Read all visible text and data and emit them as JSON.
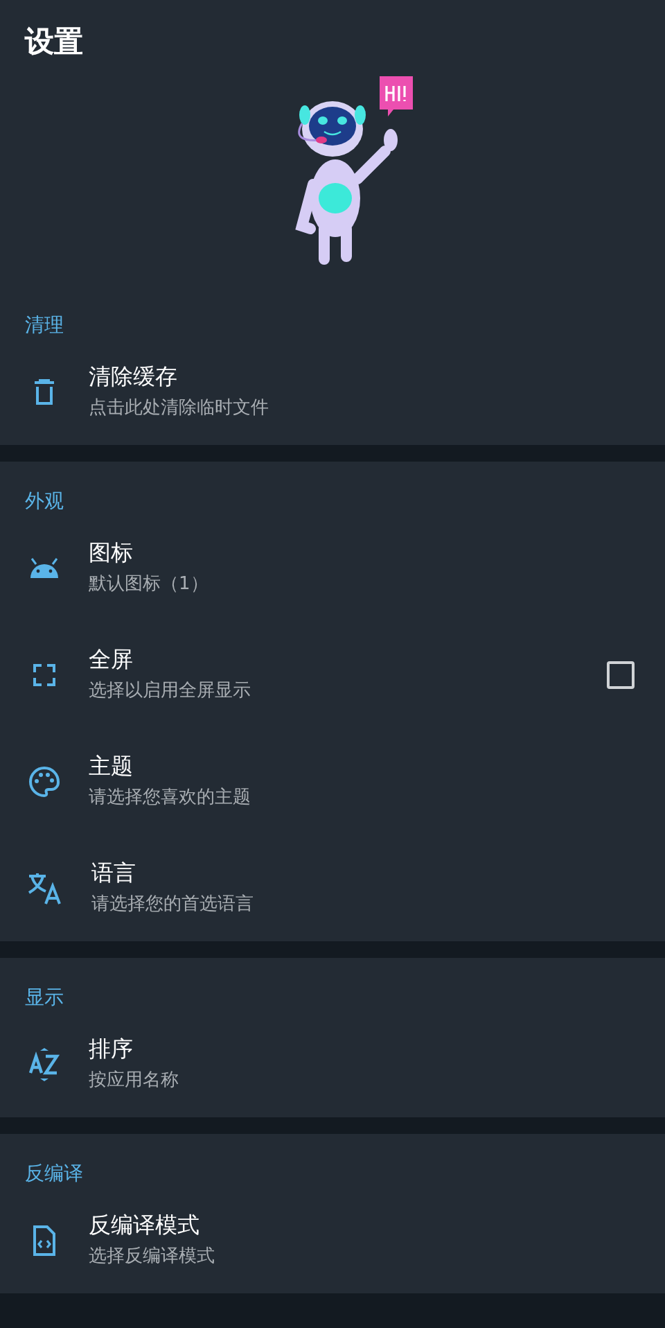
{
  "title": "设置",
  "sections": [
    {
      "label": "清理",
      "items": [
        {
          "kind": "plain",
          "title": "清除缓存",
          "subtitle": "点击此处清除临时文件"
        }
      ]
    },
    {
      "label": "外观",
      "items": [
        {
          "kind": "plain",
          "title": "图标",
          "subtitle": "默认图标（1）"
        },
        {
          "kind": "checkbox",
          "title": "全屏",
          "subtitle": "选择以启用全屏显示",
          "checked": false
        },
        {
          "kind": "plain",
          "title": "主题",
          "subtitle": "请选择您喜欢的主题"
        },
        {
          "kind": "plain",
          "title": "语言",
          "subtitle": "请选择您的首选语言"
        }
      ]
    },
    {
      "label": "显示",
      "items": [
        {
          "kind": "plain",
          "title": "排序",
          "subtitle": "按应用名称"
        }
      ]
    },
    {
      "label": "反编译",
      "items": [
        {
          "kind": "plain",
          "title": "反编译模式",
          "subtitle": "选择反编译模式"
        }
      ]
    }
  ]
}
